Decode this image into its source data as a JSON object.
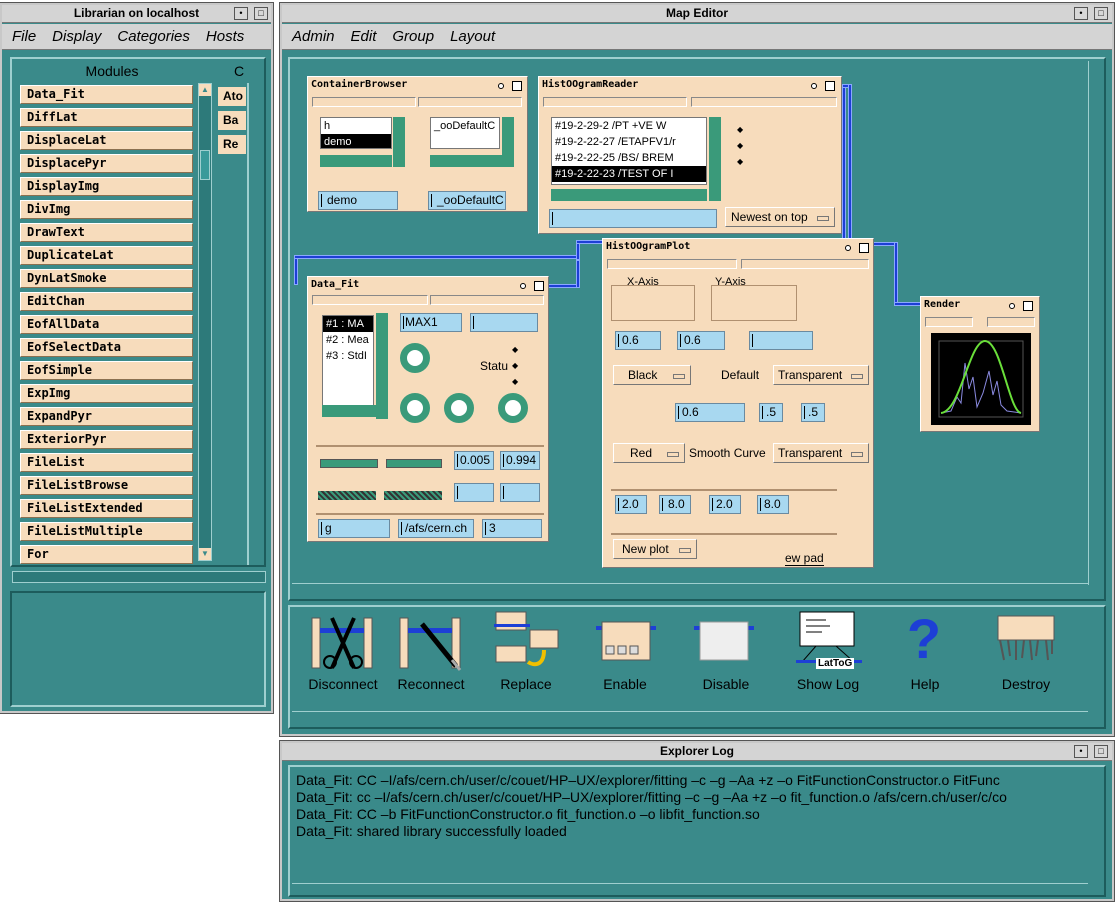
{
  "librarian": {
    "title": "Librarian on localhost",
    "menu": [
      "File",
      "Display",
      "Categories",
      "Hosts"
    ],
    "modules_header": "Modules",
    "categories_header_partial": "C",
    "modules": [
      "Data_Fit",
      "DiffLat",
      "DisplaceLat",
      "DisplacePyr",
      "DisplayImg",
      "DivImg",
      "DrawText",
      "DuplicateLat",
      "DynLatSmoke",
      "EditChan",
      "EofAllData",
      "EofSelectData",
      "EofSimple",
      "ExpImg",
      "ExpandPyr",
      "ExteriorPyr",
      "FileList",
      "FileListBrowse",
      "FileListExtended",
      "FileListMultiple",
      "For"
    ],
    "category_buttons": [
      "Ato",
      "Ba",
      "Re"
    ]
  },
  "map_editor": {
    "title": "Map Editor",
    "menu": [
      "Admin",
      "Edit",
      "Group",
      "Layout"
    ],
    "container_browser": {
      "title": "ContainerBrowser",
      "list_left": [
        "h",
        "demo"
      ],
      "list_left_selected": 1,
      "list_right": [
        "_ooDefaultC"
      ],
      "field_left": "demo",
      "field_right": "_ooDefaultC"
    },
    "histogram_reader": {
      "title": "HistOOgramReader",
      "items": [
        "#19-2-29-2 /PT    +VE    W",
        "#19-2-22-27 /ETAPFV1/r",
        "#19-2-22-25 /BS/ BREM",
        "#19-2-22-23 /TEST OF I"
      ],
      "selected": 3,
      "option": "Newest on top",
      "field": ""
    },
    "data_fit": {
      "title": "Data_Fit",
      "items": [
        "#1 : MA",
        "#2 : Mea",
        "#3 : StdI"
      ],
      "selected": 0,
      "field_a": "MAX1",
      "field_b": "",
      "status_label": "Statu",
      "value_1": "0.005",
      "value_2": "0.994",
      "field_bottom_1": "g",
      "field_bottom_2": "/afs/cern.ch",
      "field_bottom_3": "3"
    },
    "histogram_plot": {
      "title": "HistOOgramPlot",
      "x_axis_label": "X-Axis",
      "y_axis_label": "Y-Axis",
      "field_1": "0.6",
      "field_2": "0.6",
      "field_3": "",
      "color_1": "Black",
      "default_label": "Default",
      "transparent_1": "Transparent",
      "field_4": "0.6",
      "field_5": ".5",
      "field_6": ".5",
      "color_2": "Red",
      "smooth_label": "Smooth Curve",
      "transparent_2": "Transparent",
      "range_1": "2.0",
      "range_2": "8.0",
      "range_3": "2.0",
      "range_4": "8.0",
      "new_plot": "New plot",
      "new_pad": "ew pad"
    },
    "render": {
      "title": "Render"
    },
    "toolbar": [
      "Disconnect",
      "Reconnect",
      "Replace",
      "Enable",
      "Disable",
      "Show Log",
      "Help",
      "Destroy"
    ],
    "show_log_icon_text": "LatToG"
  },
  "explorer_log": {
    "title": "Explorer Log",
    "lines": [
      "Data_Fit:  CC –I/afs/cern.ch/user/c/couet/HP–UX/explorer/fitting –c –g –Aa +z –o FitFunctionConstructor.o FitFunc",
      "Data_Fit:  cc –I/afs/cern.ch/user/c/couet/HP–UX/explorer/fitting –c –g –Aa +z –o fit_function.o /afs/cern.ch/user/c/co",
      "Data_Fit:  CC –b FitFunctionConstructor.o fit_function.o –o libfit_function.so",
      "Data_Fit: shared library successfully loaded"
    ]
  },
  "colors": {
    "teal": "#3a8a8a",
    "module_peach": "#f7dcbc",
    "field_blue": "#a8d8f0",
    "wire_blue": "#1d3fd6"
  }
}
